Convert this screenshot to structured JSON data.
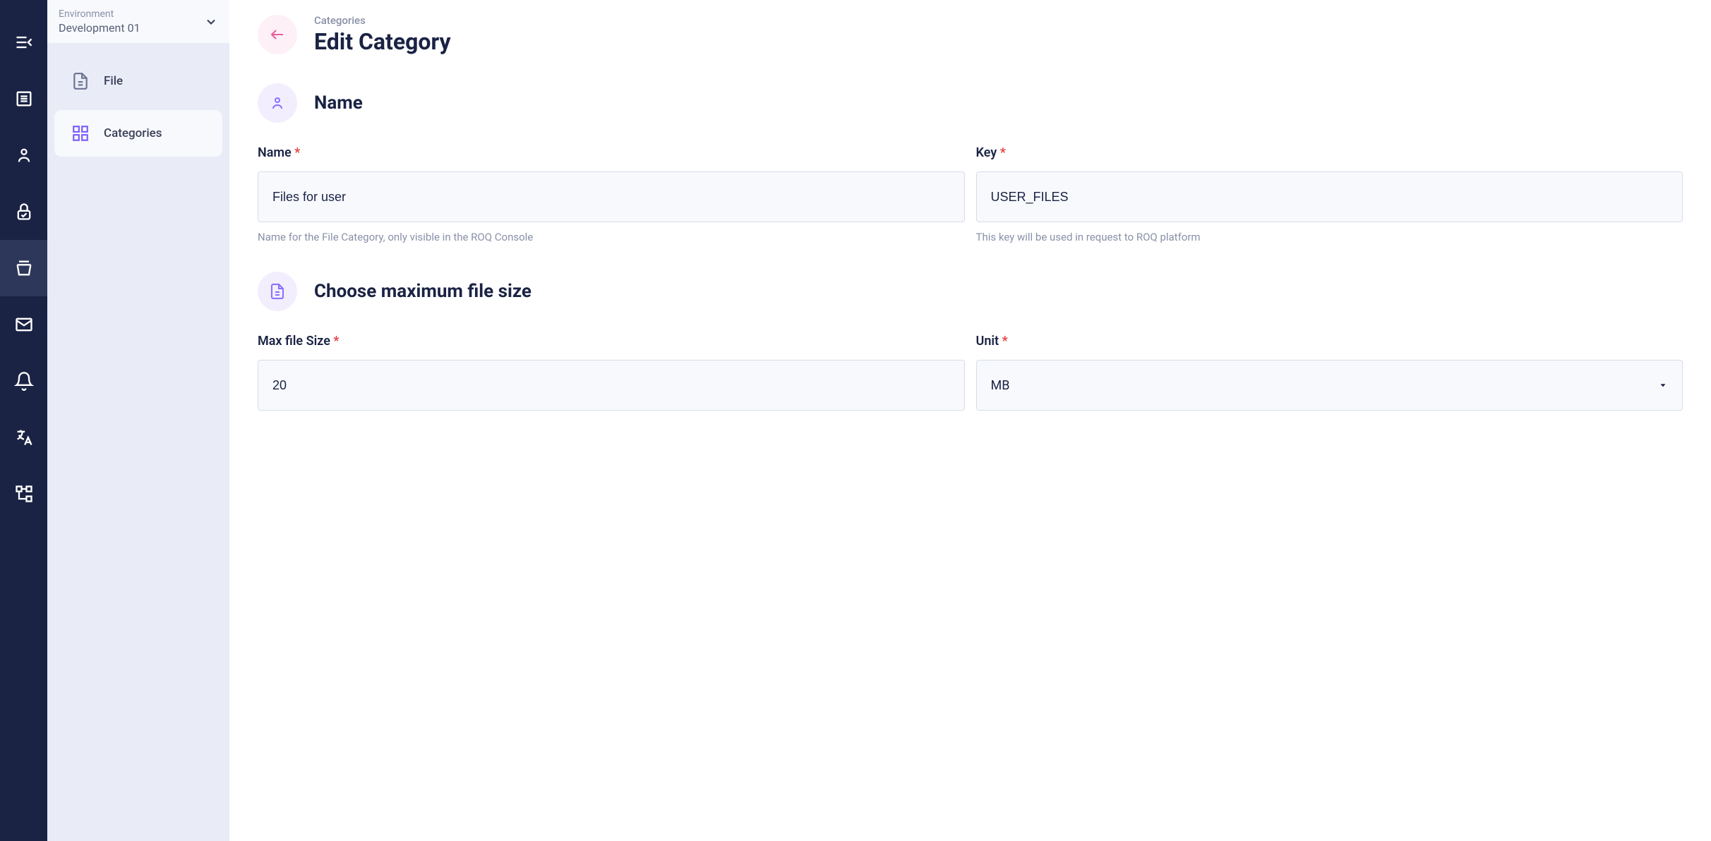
{
  "env": {
    "label": "Environment",
    "name": "Development 01"
  },
  "sidebar": {
    "items": [
      {
        "label": "File"
      },
      {
        "label": "Categories"
      }
    ]
  },
  "page": {
    "breadcrumb": "Categories",
    "title": "Edit Category"
  },
  "sections": {
    "name": {
      "title": "Name"
    },
    "filesize": {
      "title": "Choose maximum file size"
    }
  },
  "form": {
    "name": {
      "label": "Name",
      "value": "Files for user",
      "help": "Name for the File Category, only visible in the ROQ Console"
    },
    "key": {
      "label": "Key",
      "value": "USER_FILES",
      "help": "This key will be used in request to ROQ platform"
    },
    "maxsize": {
      "label": "Max file Size",
      "value": "20"
    },
    "unit": {
      "label": "Unit",
      "value": "MB"
    }
  }
}
